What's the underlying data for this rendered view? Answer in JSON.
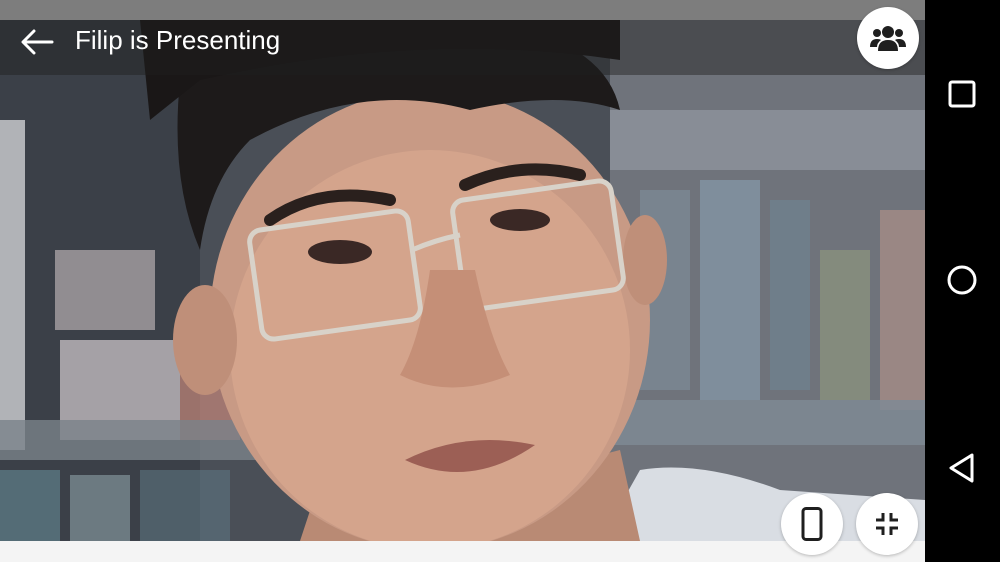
{
  "toolbar": {
    "title": "Filip is Presenting",
    "back_icon": "arrow-back-icon",
    "participants_icon": "participants-icon"
  },
  "video": {
    "content": "person-video-feed"
  },
  "controls": {
    "phone_icon": "smartphone-icon",
    "exit_fullscreen_icon": "exit-fullscreen-icon"
  },
  "nav_bar": {
    "recents_icon": "recents-square-icon",
    "home_icon": "home-circle-icon",
    "back_icon": "back-triangle-icon"
  },
  "colors": {
    "toolbar_overlay": "#1e1e1e",
    "status_bar": "#7d7d7d",
    "button_bg": "#ffffff",
    "icon_color": "#1f1f1f",
    "nav_bar_bg": "#000000"
  }
}
